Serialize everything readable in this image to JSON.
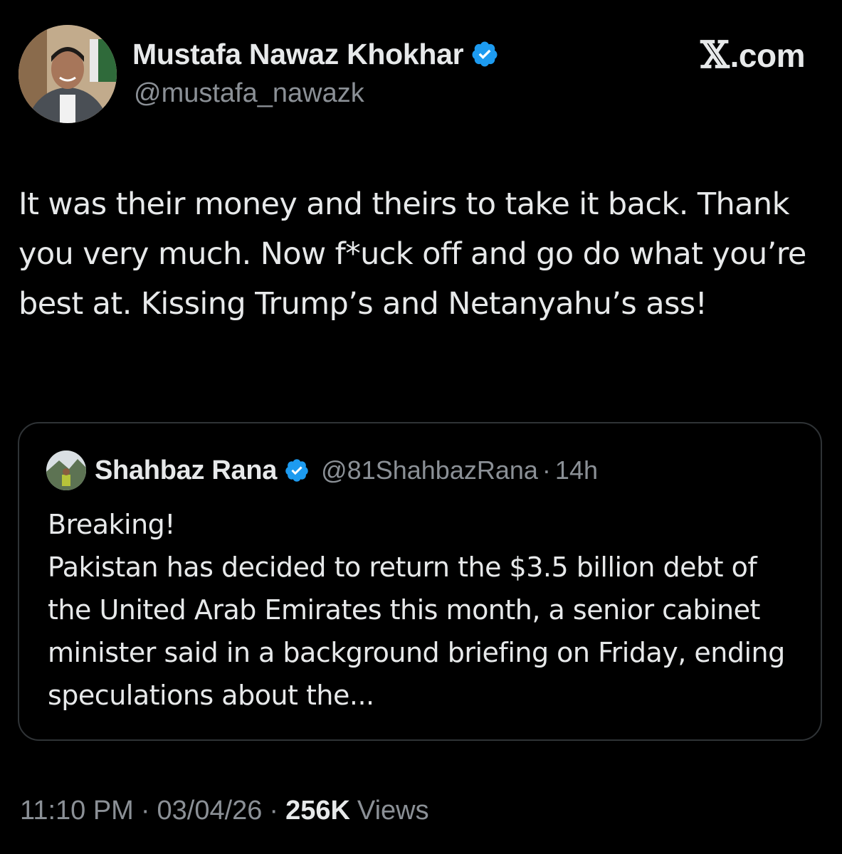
{
  "tweet": {
    "author": {
      "name": "Mustafa Nawaz Khokhar",
      "handle": "@mustafa_nawazk",
      "verified": true,
      "avatar_icon": "profile-photo"
    },
    "site_logo": {
      "mark": "𝕏",
      "suffix": ".com"
    },
    "text": "It was their money and theirs to take it back. Thank you very much. Now f*uck off and go do what you’re best at. Kissing Trump’s and Netanyahu’s ass!",
    "quoted": {
      "name": "Shahbaz Rana",
      "handle": "@81ShahbazRana",
      "separator": "·",
      "time": "14h",
      "verified": true,
      "text": "Breaking!\nPakistan has decided to return the $3.5 billion debt of the United Arab Emirates this month, a senior cabinet minister said in a background briefing on Friday, ending speculations about the..."
    },
    "meta": {
      "time": "11:10 PM",
      "separator": "·",
      "date": "03/04/26",
      "views_count": "256K",
      "views_label": "Views"
    }
  },
  "colors": {
    "background": "#000000",
    "text_primary": "#e7e9ea",
    "text_secondary": "#8b9096",
    "verified_badge": "#1d9bf0",
    "card_border": "#2f3336"
  }
}
